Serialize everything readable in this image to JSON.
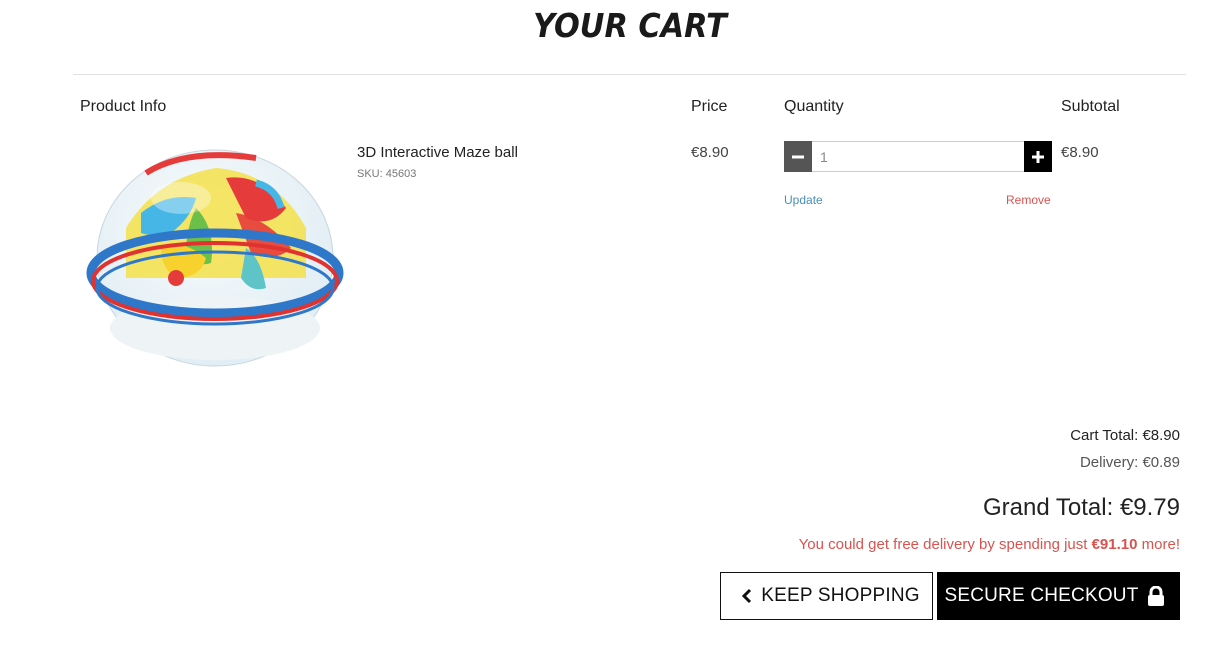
{
  "page": {
    "title": "YOUR CART"
  },
  "table": {
    "headers": {
      "product": "Product Info",
      "price": "Price",
      "quantity": "Quantity",
      "subtotal": "Subtotal"
    },
    "items": [
      {
        "name": "3D Interactive Maze ball",
        "sku": "SKU: 45603",
        "price": "€8.90",
        "quantity": "1",
        "subtotal": "€8.90",
        "update_label": "Update",
        "remove_label": "Remove"
      }
    ]
  },
  "summary": {
    "cart_total": "Cart Total: €8.90",
    "delivery": "Delivery: €0.89",
    "grand_total": "Grand Total: €9.79",
    "free_delivery_prefix": "You could get free delivery by spending just ",
    "free_delivery_amount": "€91.10",
    "free_delivery_suffix": " more!"
  },
  "buttons": {
    "keep_shopping": "KEEP SHOPPING",
    "secure_checkout": "SECURE CHECKOUT"
  },
  "icons": {
    "keep_shopping": "chevron-left-icon",
    "checkout": "lock-icon",
    "minus": "minus-icon",
    "plus": "plus-icon"
  },
  "colors": {
    "remove_link": "#d9534f",
    "update_link": "#4a8fb8",
    "free_delivery_text": "#d9534f",
    "checkout_bg": "#000000"
  }
}
